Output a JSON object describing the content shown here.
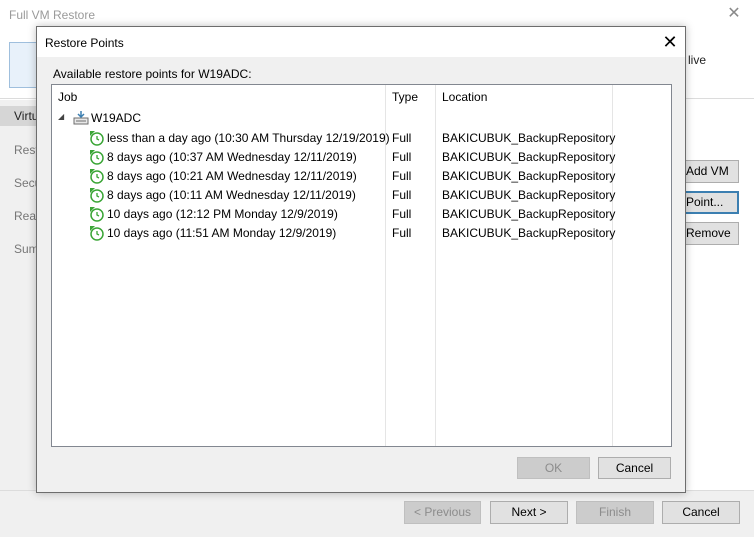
{
  "wizard": {
    "title": "Full VM Restore",
    "header_text": "live",
    "nav": [
      "Virtu",
      "Rest",
      "Secu",
      "Reas",
      "Sum"
    ],
    "side_buttons": {
      "add_vm": "Add VM",
      "point": "Point...",
      "remove": "Remove"
    },
    "footer": {
      "previous": "< Previous",
      "next": "Next >",
      "finish": "Finish",
      "cancel": "Cancel"
    }
  },
  "dialog": {
    "title": "Restore Points",
    "subtitle": "Available restore points for W19ADC:",
    "columns": {
      "job": "Job",
      "type": "Type",
      "location": "Location"
    },
    "server": "W19ADC",
    "restore_points": [
      {
        "name": "less than a day ago (10:30 AM Thursday 12/19/2019)",
        "type": "Full",
        "location": "BAKICUBUK_BackupRepository"
      },
      {
        "name": "8 days ago (10:37 AM Wednesday 12/11/2019)",
        "type": "Full",
        "location": "BAKICUBUK_BackupRepository"
      },
      {
        "name": "8 days ago (10:21 AM Wednesday 12/11/2019)",
        "type": "Full",
        "location": "BAKICUBUK_BackupRepository"
      },
      {
        "name": "8 days ago (10:11 AM Wednesday 12/11/2019)",
        "type": "Full",
        "location": "BAKICUBUK_BackupRepository"
      },
      {
        "name": "10 days ago (12:12 PM Monday 12/9/2019)",
        "type": "Full",
        "location": "BAKICUBUK_BackupRepository"
      },
      {
        "name": "10 days ago (11:51 AM Monday 12/9/2019)",
        "type": "Full",
        "location": "BAKICUBUK_BackupRepository"
      }
    ],
    "buttons": {
      "ok": "OK",
      "cancel": "Cancel"
    }
  },
  "icons": {
    "close": "close-icon",
    "restore_point": "restore-point-icon",
    "server": "server-icon"
  },
  "colors": {
    "accent": "#3c7fb1",
    "icon_green": "#3aa536"
  }
}
